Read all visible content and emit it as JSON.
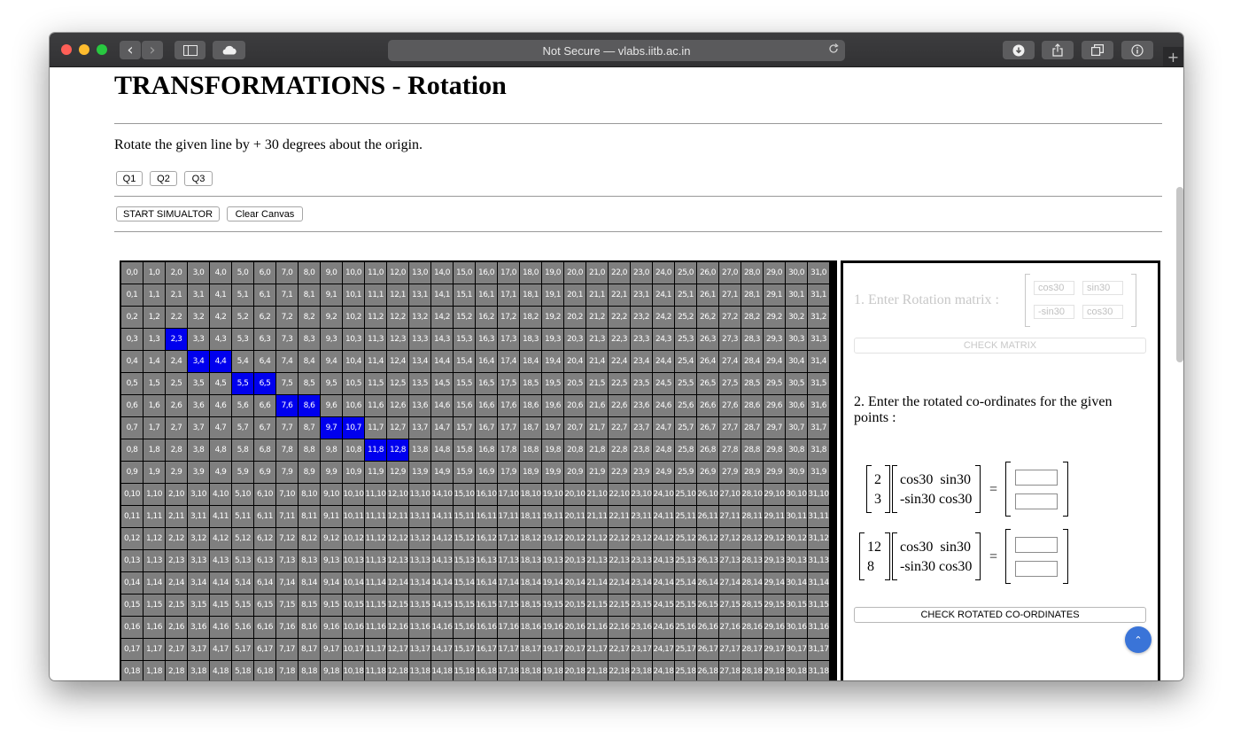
{
  "browser": {
    "url_text": "Not Secure — vlabs.iitb.ac.in",
    "buttons": {
      "back": "‹",
      "forward": "›",
      "new_tab": "+"
    },
    "icons": [
      "back-icon",
      "forward-icon",
      "sidebar-icon",
      "cloud-icon",
      "reload-icon",
      "download-icon",
      "share-icon",
      "tabs-icon",
      "info-icon"
    ]
  },
  "page": {
    "title": "TRANSFORMATIONS - Rotation",
    "question": "Rotate the given line by + 30 degrees about the origin.",
    "q_buttons": [
      "Q1",
      "Q2",
      "Q3"
    ],
    "start_button": "START SIMUALTOR",
    "clear_button": "Clear Canvas"
  },
  "grid": {
    "cols": 32,
    "rows": 19,
    "highlighted": [
      [
        2,
        3
      ],
      [
        3,
        4
      ],
      [
        4,
        4
      ],
      [
        5,
        5
      ],
      [
        6,
        5
      ],
      [
        7,
        6
      ],
      [
        8,
        6
      ],
      [
        9,
        7
      ],
      [
        10,
        7
      ],
      [
        11,
        8
      ],
      [
        12,
        8
      ]
    ],
    "highlight_color": "#0000ee",
    "cell_color": "#7f7f7f"
  },
  "panel": {
    "step1_label": "1. Enter Rotation matrix :",
    "matrix_placeholders": [
      "cos30",
      "sin30",
      "-sin30",
      "cos30"
    ],
    "check_matrix": "CHECK MATRIX",
    "step2_label": "2. Enter the rotated co-ordinates for the given points :",
    "equations": [
      {
        "point": [
          "2",
          "3"
        ],
        "row1": "cos30  sin30",
        "row2": "-sin30 cos30",
        "equals": "="
      },
      {
        "point": [
          "12",
          "8"
        ],
        "row1": "cos30  sin30",
        "row2": "-sin30 cos30",
        "equals": "="
      }
    ],
    "check_coords": "CHECK ROTATED CO-ORDINATES",
    "scroll_top_icon": "⌃"
  }
}
